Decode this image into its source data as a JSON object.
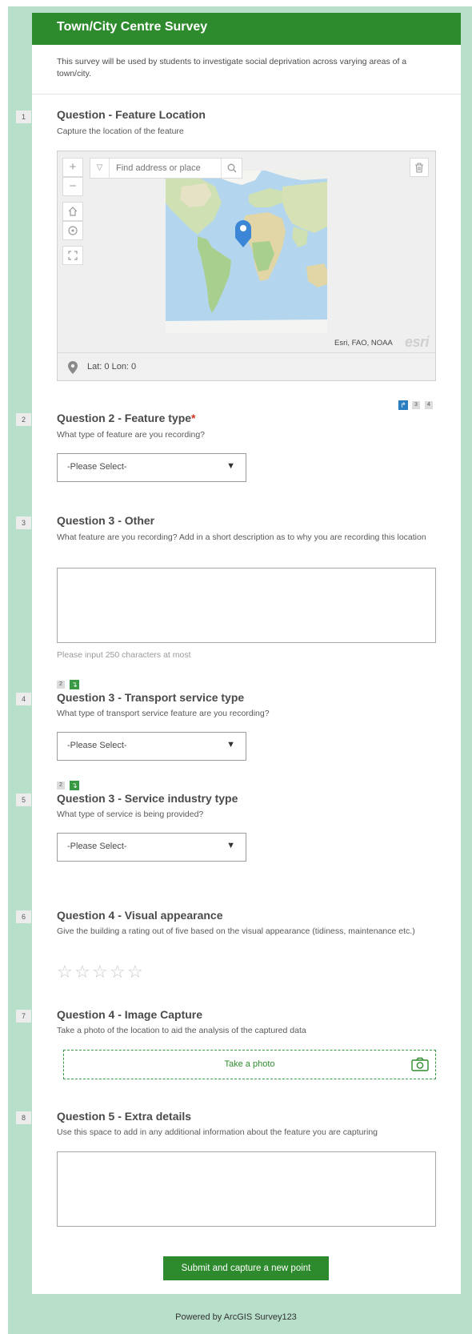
{
  "header": {
    "title": "Town/City Centre Survey"
  },
  "description": "This survey will be used by students to investigate social deprivation across varying areas of a town/city.",
  "q1": {
    "num": "1",
    "title": "Question - Feature Location",
    "hint": "Capture the location of the feature",
    "map": {
      "search_placeholder": "Find address or place",
      "attribution": "Esri, FAO, NOAA",
      "logo": "esri",
      "coords": "Lat: 0 Lon: 0",
      "icons": [
        "zoom-in-icon",
        "zoom-out-icon",
        "home-icon",
        "locate-icon",
        "fullscreen-icon",
        "search-icon",
        "trash-icon",
        "map-pin-icon"
      ]
    }
  },
  "q2": {
    "num": "2",
    "title": "Question 2 - Feature type",
    "required_mark": "*",
    "hint": "What type of feature are you recording?",
    "select": "-Please Select-",
    "badges": [
      "3",
      "4"
    ]
  },
  "q3": {
    "num": "3",
    "title": "Question 3 - Other",
    "hint": "What feature are you recording? Add in a short description as to why you are recording this location",
    "char_hint": "Please input 250 characters at most"
  },
  "q4": {
    "num": "4",
    "badge": "2",
    "title": "Question 3 - Transport service type",
    "hint": "What type of transport service feature are you recording?",
    "select": "-Please Select-"
  },
  "q5": {
    "num": "5",
    "badge": "2",
    "title": "Question 3 - Service industry type",
    "hint": "What type of service is being provided?",
    "select": "-Please Select-"
  },
  "q6": {
    "num": "6",
    "title": "Question 4 - Visual appearance",
    "hint": "Give the building a rating out of five based on the visual appearance (tidiness, maintenance etc.)",
    "rating": 0,
    "max_rating": 5
  },
  "q7": {
    "num": "7",
    "title": "Question 4 - Image Capture",
    "hint": "Take a photo of the location to aid the analysis of the captured data",
    "photo_label": "Take a photo"
  },
  "q8": {
    "num": "8",
    "title": "Question 5 - Extra details",
    "hint": "Use this space to add in any additional information about the feature you are capturing"
  },
  "submit_label": "Submit and capture a new point",
  "footer": "Powered by ArcGIS Survey123",
  "colors": {
    "brand_green": "#2e8b2d",
    "page_bg": "#b7dfc9",
    "required": "#d83020",
    "badge_blue": "#2b7fc1"
  }
}
